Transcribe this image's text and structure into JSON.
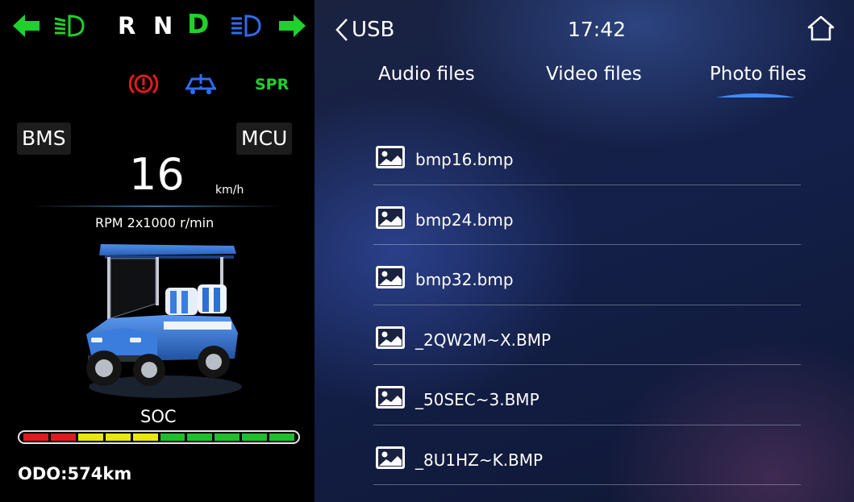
{
  "dashboard": {
    "gears": [
      "R",
      "N",
      "D"
    ],
    "active_gear": "D",
    "spr_label": "SPR",
    "bms_label": "BMS",
    "mcu_label": "MCU",
    "speed": "16",
    "speed_unit": "km/h",
    "rpm_text": "RPM 2x1000 r/min",
    "soc_label": "SOC",
    "soc_segments": [
      "#e01b1b",
      "#e01b1b",
      "#e8e80a",
      "#e8e80a",
      "#e8e80a",
      "#1fbf2c",
      "#1fbf2c",
      "#1fbf2c",
      "#1fbf2c",
      "#1fbf2c"
    ],
    "odo": "ODO:574km",
    "colors": {
      "green": "#1fd12c",
      "blue": "#2f6cf0",
      "red": "#e01b1b",
      "amber": "#e8e80a"
    }
  },
  "header": {
    "back_label": "USB",
    "time": "17:42"
  },
  "tabs": [
    {
      "label": "Audio files"
    },
    {
      "label": "Video files"
    },
    {
      "label": "Photo files",
      "active": true
    }
  ],
  "files": [
    {
      "name": "bmp16.bmp",
      "icon": "image-icon"
    },
    {
      "name": "bmp24.bmp",
      "icon": "image-icon"
    },
    {
      "name": "bmp32.bmp",
      "icon": "image-icon"
    },
    {
      "name": "_2QW2M~X.BMP",
      "icon": "image-icon"
    },
    {
      "name": "_50SEC~3.BMP",
      "icon": "image-icon"
    },
    {
      "name": "_8U1HZ~K.BMP",
      "icon": "image-icon"
    }
  ]
}
